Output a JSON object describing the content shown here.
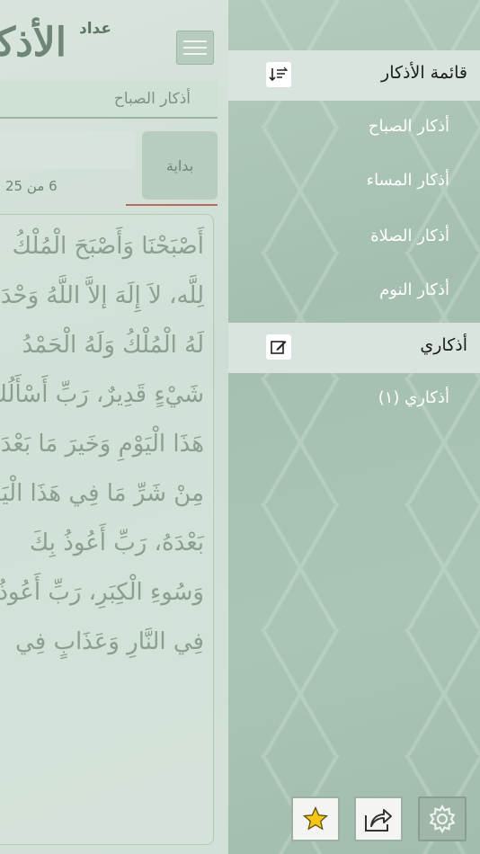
{
  "main": {
    "app_title": "عداد",
    "logo_text": "الأذكار",
    "section_name": "أذكار الصباح",
    "start_label": "بداية",
    "progress": "6 من 25",
    "zikr_text": "أَصْبَحْنَا وَأَصْبَحَ الْمُلْكُ\nلِلَّه، لاَ إِلَهَ إلاَّ اللَّهُ وَحْدَهُ\nلَهُ الْمُلْكُ وَلَهُ الْحَمْدُ\nشَيْءٍ قَدِيرٌ، رَبِّ أَسْأَلُكَ\nهَذَا الْيَوْمِ وَخَيرَ مَا بَعْدَهُ\nمِنْ شَرِّ مَا فِي هَذَا الْيَوْمِ\nبَعْدَهُ، رَبِّ أَعُوذُ بِكَ\nوَسُوءِ الْكِبَرِ، رَبِّ أَعُوذُ\nفِي النَّارِ وَعَذَابٍ فِي"
  },
  "side_menu": {
    "list_header": "قائمة الأذكار",
    "list_header_icon": "sort-icon",
    "items": [
      {
        "label": "أذكار الصباح"
      },
      {
        "label": "أذكار المساء"
      },
      {
        "label": "أذكار الصلاة"
      },
      {
        "label": "أذكار النوم"
      }
    ],
    "my_header": "أذكاري",
    "my_header_icon": "edit-icon",
    "my_items": [
      {
        "label": "أذكاري (١)"
      }
    ]
  },
  "toolbar": {
    "favorite_icon": "star-icon",
    "share_icon": "share-icon",
    "settings_icon": "gear-icon"
  },
  "colors": {
    "menu_background": "#a9c4b4",
    "header_background": "#d9e4de",
    "menu_text": "#ffffff",
    "star": "#f5c518"
  }
}
